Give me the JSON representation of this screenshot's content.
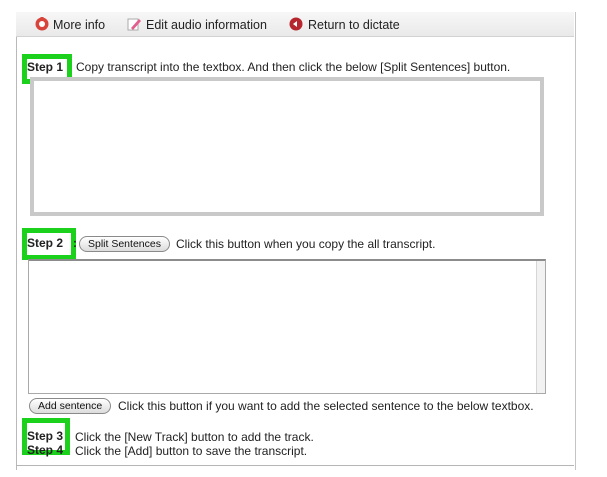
{
  "toolbar": {
    "more_info": "More info",
    "edit_audio": "Edit audio information",
    "return_dictate": "Return to dictate"
  },
  "step1": {
    "label": "Step 1",
    "text": "Copy transcript into the textbox. And then click the below [Split Sentences] button."
  },
  "step2": {
    "label": "Step 2",
    "colon": ":",
    "button": "Split Sentences",
    "text": "Click this button when you copy the all transcript."
  },
  "add_sentence": {
    "button": "Add sentence",
    "text": "Click this button if you want to add the selected sentence to the below textbox."
  },
  "step3": {
    "label": "Step 3",
    "text": "Click the [New Track] button to add the track."
  },
  "step4": {
    "label": "Step 4",
    "text": "Click the [Add] button to save the transcript."
  },
  "colors": {
    "highlight": "#1bd11b"
  }
}
